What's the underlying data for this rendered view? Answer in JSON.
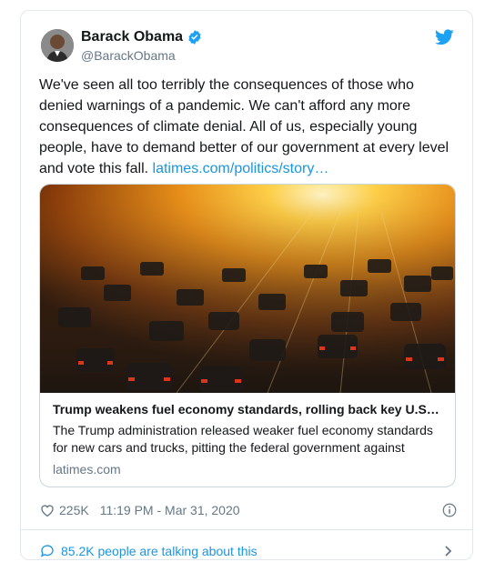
{
  "author": {
    "name": "Barack Obama",
    "handle": "@BarackObama"
  },
  "tweet": {
    "text": "We've seen all too terribly the consequences of those who denied warnings of a pandemic. We can't afford any more consequences of climate denial. All of us, especially young people, have to demand better of our government at every level and vote this fall. ",
    "link_text": "latimes.com/politics/story…"
  },
  "link_card": {
    "title": "Trump weakens fuel economy standards, rolling back key U.S…",
    "description": "The Trump administration released weaker fuel economy standards for new cars and trucks, pitting the federal government against",
    "domain": "latimes.com"
  },
  "footer": {
    "likes": "225K",
    "timestamp": "11:19 PM - Mar 31, 2020",
    "talking": "85.2K people are talking about this"
  },
  "colors": {
    "accent": "#1b95e0",
    "verified": "#1da1f2",
    "muted": "#657786"
  },
  "icons": [
    "verified-badge-icon",
    "twitter-bird-icon",
    "heart-icon",
    "info-icon",
    "comment-bubble-icon",
    "chevron-right-icon"
  ]
}
